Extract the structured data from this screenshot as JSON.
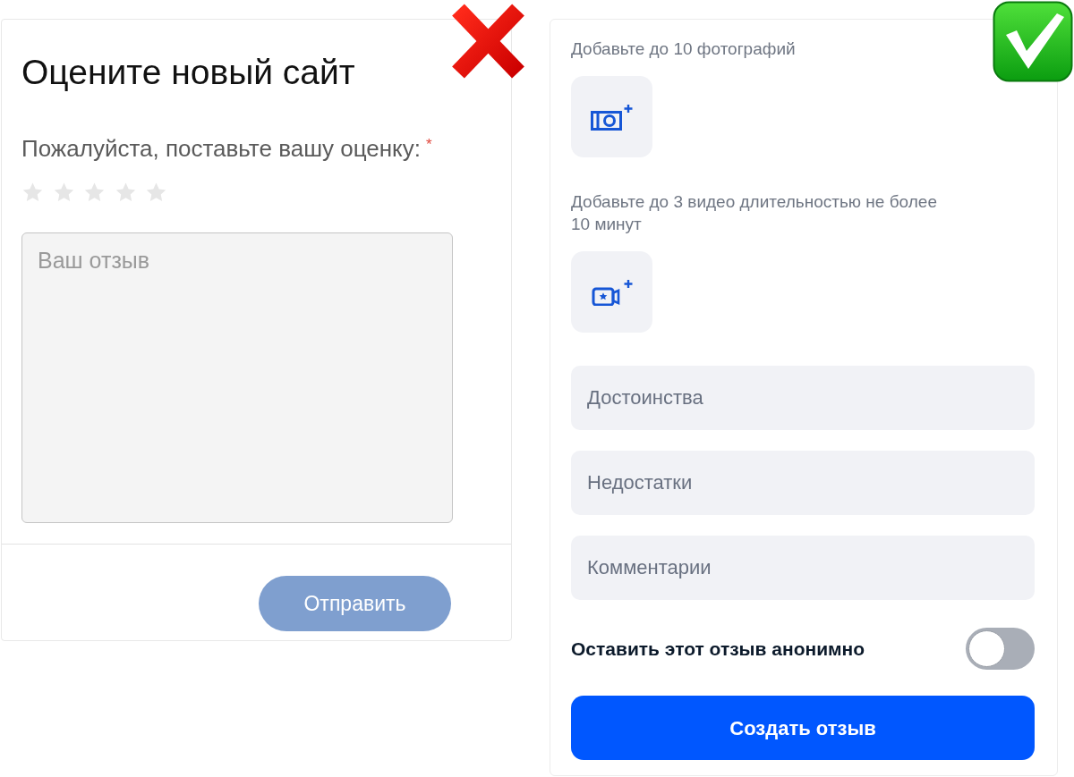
{
  "left_form": {
    "correct": false,
    "title": "Оцените новый сайт",
    "rating": {
      "label": "Пожалуйста, поставьте вашу оценку:",
      "required_mark": "*",
      "stars": 0
    },
    "review": {
      "placeholder": "Ваш отзыв"
    },
    "submit": {
      "label": "Отправить",
      "disabled": true
    }
  },
  "right_form": {
    "correct": true,
    "photos": {
      "hint": "Добавьте до 10 фотографий"
    },
    "videos": {
      "hint": "Добавьте до 3 видео длительностью не более 10 минут"
    },
    "fields": [
      {
        "placeholder": "Достоинства"
      },
      {
        "placeholder": "Недостатки"
      },
      {
        "placeholder": "Комментарии"
      }
    ],
    "anonymous": {
      "label": "Оставить этот отзыв анонимно",
      "on": false
    },
    "submit": {
      "label": "Создать отзыв",
      "disabled": false
    }
  }
}
